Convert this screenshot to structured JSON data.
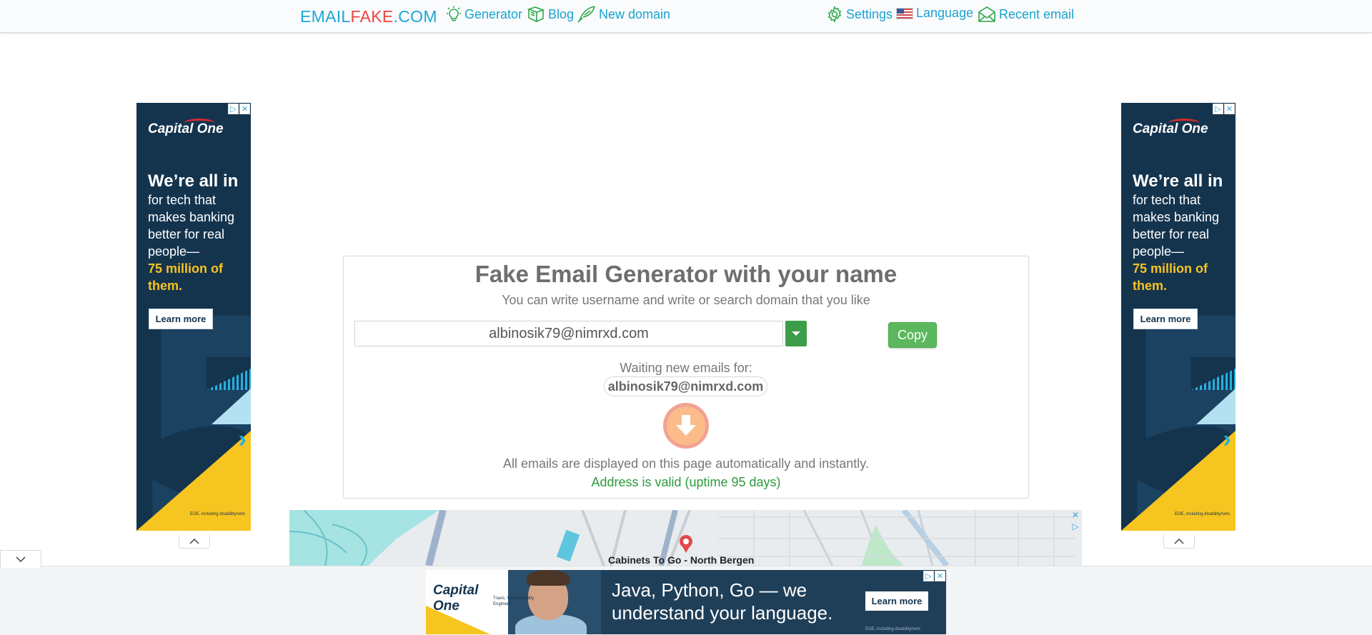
{
  "nav": {
    "brand": {
      "part1": "EMAIL",
      "part2": "FAKE",
      "part3": ".COM"
    },
    "links": [
      {
        "label": "Generator",
        "icon": "lightbulb-icon"
      },
      {
        "label": "Blog",
        "icon": "book-icon"
      },
      {
        "label": "New domain",
        "icon": "pen-icon"
      },
      {
        "label": "Settings",
        "icon": "gear-icon"
      },
      {
        "label": "Language",
        "icon": "us-flag-icon"
      },
      {
        "label": "Recent email",
        "icon": "envelope-icon"
      }
    ]
  },
  "main": {
    "title": "Fake Email Generator with your name",
    "subtitle": "You can write username and write or search domain that you like",
    "email_value": "albinosik79@nimrxd.com",
    "copy_label": "Copy",
    "waiting_label": "Waiting new emails for:",
    "waiting_address": "albinosik79@nimrxd.com",
    "auto_note": "All emails are displayed on this page automatically and instantly.",
    "valid_note": "Address is valid (uptime 95 days)"
  },
  "side_ad": {
    "brand": "Capital One",
    "headline": "We’re all in",
    "body": "for tech that makes banking better for real people—",
    "highlight": "75 million of them.",
    "cta": "Learn more",
    "fine_print": "EOE, including disability/vets"
  },
  "map_ad": {
    "place_label": "Cabinets To Go - North Bergen"
  },
  "bottom_ad": {
    "brand": "Capital One",
    "caption": "Travis, Site Reliability Engineer",
    "headline": "Java, Python, Go — we understand your language.",
    "cta": "Learn more",
    "fine_print": "EOE, including disability/vets"
  },
  "colors": {
    "brand_blue": "#1ea7d8",
    "brand_red": "#ee4444",
    "copy_green": "#5cb85c",
    "valid_green": "#2c9a3c"
  }
}
